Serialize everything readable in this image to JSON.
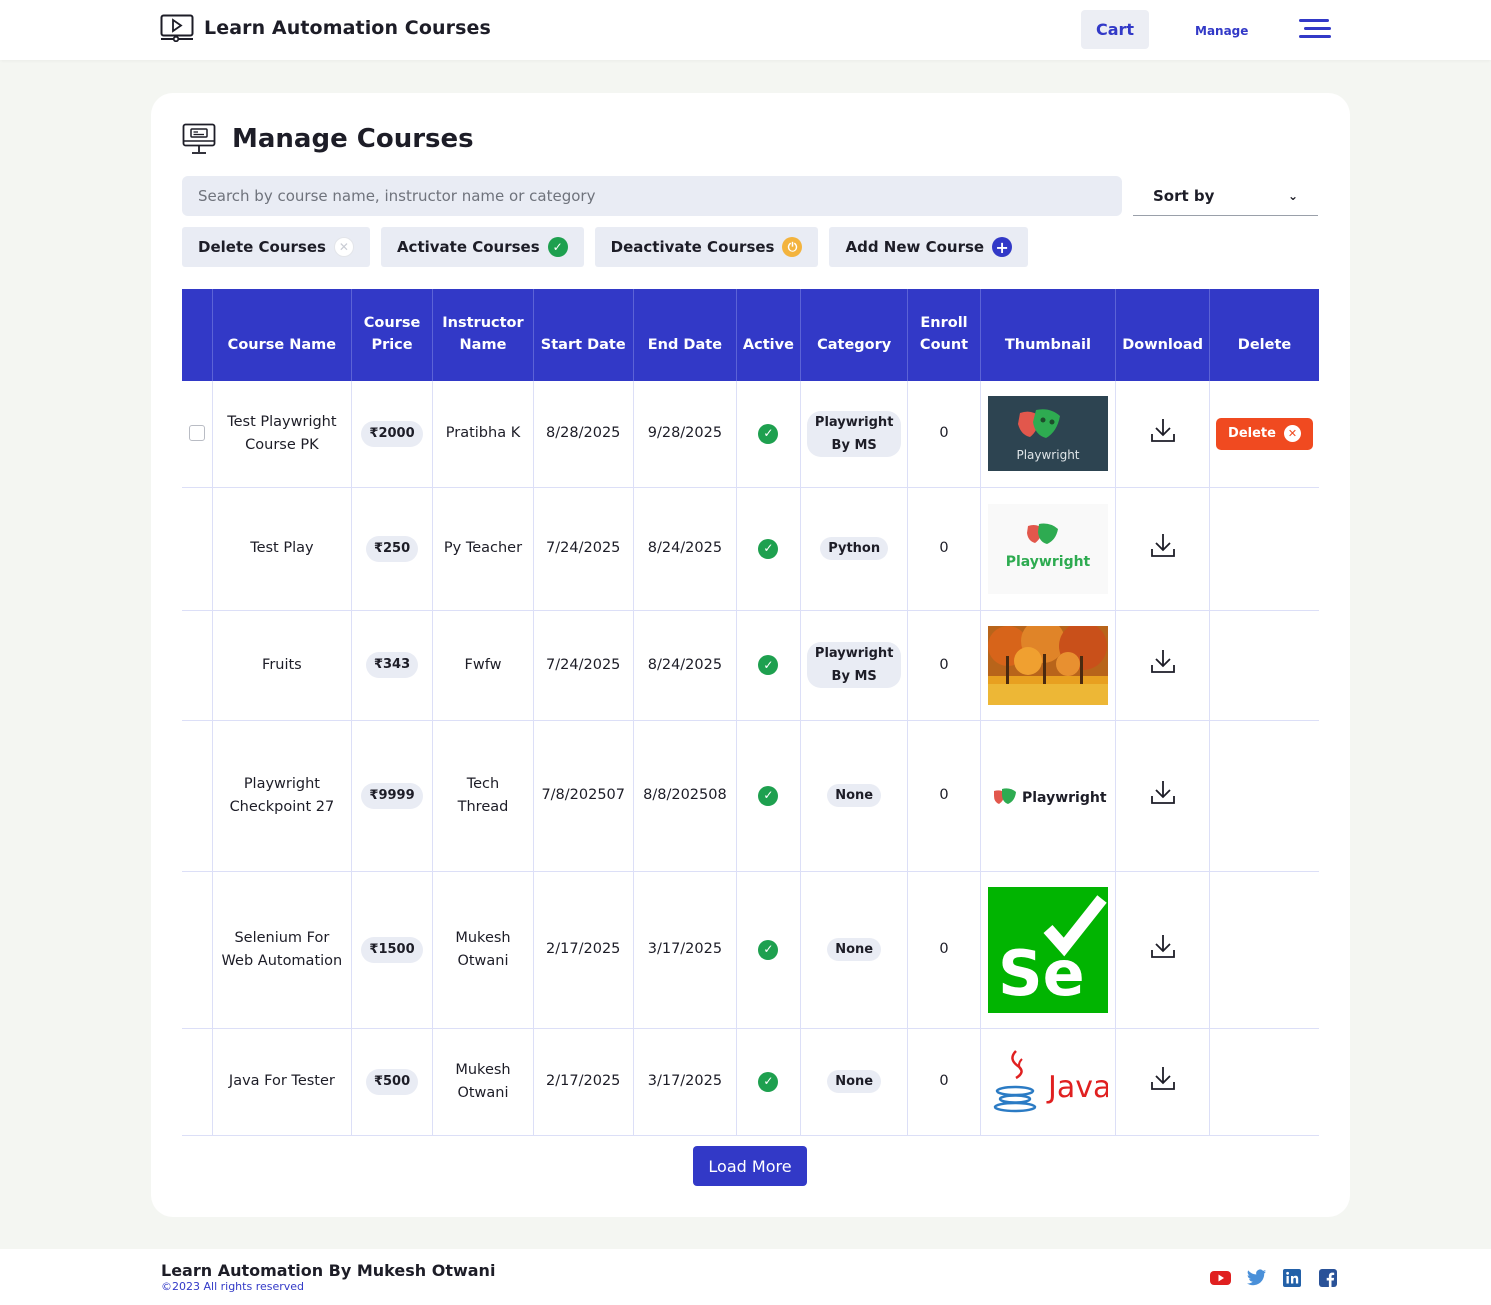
{
  "header": {
    "app_title": "Learn Automation Courses",
    "cart_label": "Cart",
    "manage_label": "Manage"
  },
  "page": {
    "title": "Manage Courses",
    "search_placeholder": "Search by course name, instructor name or category",
    "sort_label": "Sort by"
  },
  "actions": {
    "delete_label": "Delete Courses",
    "activate_label": "Activate Courses",
    "deactivate_label": "Deactivate Courses",
    "add_label": "Add New Course"
  },
  "table": {
    "headers": {
      "course_name": "Course Name",
      "course_price": "Course Price",
      "instructor": "Instructor Name",
      "start_date": "Start Date",
      "end_date": "End Date",
      "active": "Active",
      "category": "Category",
      "enroll": "Enroll Count",
      "thumbnail": "Thumbnail",
      "download": "Download",
      "delete": "Delete"
    },
    "rows": [
      {
        "name": "Test Playwright Course PK",
        "price": "₹2000",
        "instructor": "Pratibha K",
        "start": "8/28/2025",
        "end": "9/28/2025",
        "category": "Playwright By MS",
        "enroll": "0",
        "thumb": "playwright-dark",
        "thumb_text": "Playwright"
      },
      {
        "name": "Test Play",
        "price": "₹250",
        "instructor": "Py Teacher",
        "start": "7/24/2025",
        "end": "8/24/2025",
        "category": "Python",
        "enroll": "0",
        "thumb": "playwright-light",
        "thumb_text": "Playwright"
      },
      {
        "name": "Fruits",
        "price": "₹343",
        "instructor": "Fwfw",
        "start": "7/24/2025",
        "end": "8/24/2025",
        "category": "Playwright By MS",
        "enroll": "0",
        "thumb": "autumn-trees"
      },
      {
        "name": "Playwright Checkpoint 27",
        "price": "₹9999",
        "instructor": "Tech Thread",
        "start": "7/8/202507",
        "end": "8/8/202508",
        "category": "None",
        "enroll": "0",
        "thumb": "playwright-logo",
        "thumb_text": "Playwright"
      },
      {
        "name": "Selenium For Web Automation",
        "price": "₹1500",
        "instructor": "Mukesh Otwani",
        "start": "2/17/2025",
        "end": "3/17/2025",
        "category": "None",
        "enroll": "0",
        "thumb": "selenium",
        "thumb_text": "Se"
      },
      {
        "name": "Java For Tester",
        "price": "₹500",
        "instructor": "Mukesh Otwani",
        "start": "2/17/2025",
        "end": "3/17/2025",
        "category": "None",
        "enroll": "0",
        "thumb": "java",
        "thumb_text": "Java"
      }
    ],
    "delete_button_label": "Delete"
  },
  "load_more_label": "Load More",
  "footer": {
    "title": "Learn Automation By Mukesh Otwani",
    "copyright": "©2023 All rights reserved"
  },
  "colors": {
    "primary": "#3239c7",
    "success": "#1ea04f",
    "warning": "#f3b33d",
    "danger": "#f04a20"
  },
  "icons": [
    "video-player-icon",
    "menu-icon",
    "monitor-icon",
    "chevron-down-icon",
    "close-icon",
    "check-icon",
    "power-icon",
    "plus-icon",
    "download-icon",
    "youtube-icon",
    "twitter-icon",
    "linkedin-icon",
    "facebook-icon"
  ]
}
